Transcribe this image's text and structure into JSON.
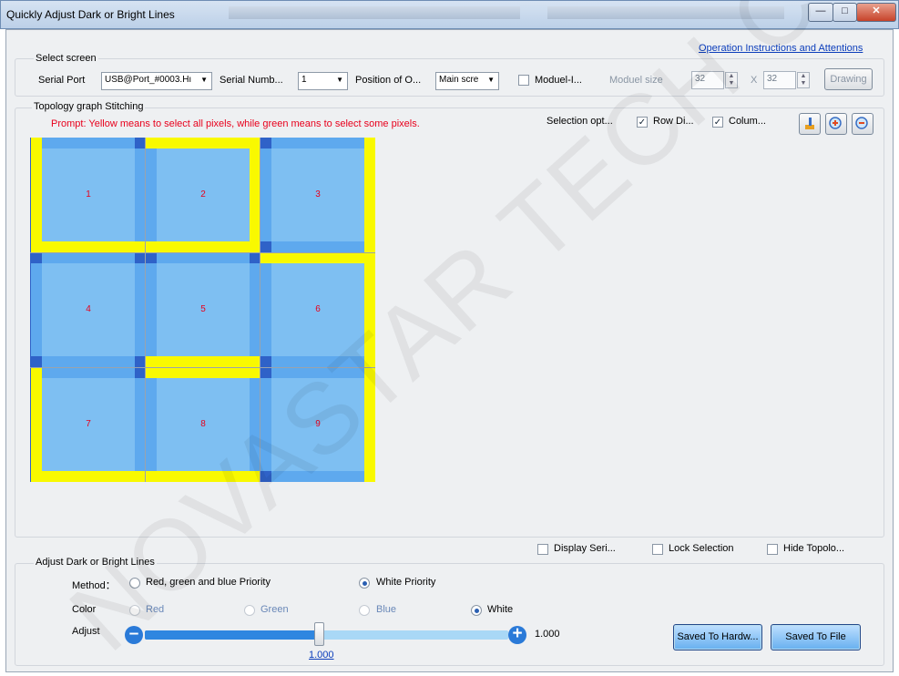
{
  "window": {
    "title": "Quickly Adjust Dark or Bright Lines"
  },
  "select_screen": {
    "group_label": "Select screen",
    "operation_link": "Operation Instructions and Attentions",
    "serial_port_label": "Serial Port",
    "serial_port_value": "USB@Port_#0003.Hı",
    "serial_number_label": "Serial Numb...",
    "serial_number_value": "1",
    "position_label": "Position of O...",
    "position_value": "Main scre",
    "module_checkbox_label": "Moduel-I...",
    "module_size_label": "Moduel size",
    "module_width": "32",
    "module_x": "X",
    "module_height": "32",
    "drawing_button": "Drawing"
  },
  "topology": {
    "group_label": "Topology graph Stitching",
    "prompt": "Prompt: Yellow means to select all pixels, while green means to select some pixels.",
    "selection_label": "Selection opt...",
    "row_checkbox_label": "Row Di...",
    "column_checkbox_label": "Colum...",
    "cells": [
      "1",
      "2",
      "3",
      "4",
      "5",
      "6",
      "7",
      "8",
      "9"
    ],
    "display_serial_label": "Display Seri...",
    "lock_selection_label": "Lock Selection",
    "hide_topology_label": "Hide Topolo..."
  },
  "adjust": {
    "group_label": "Adjust Dark or Bright Lines",
    "method_label": "Method：",
    "method_rgb": "Red, green and blue Priority",
    "method_white": "White Priority",
    "color_label": "Color",
    "color_red": "Red",
    "color_green": "Green",
    "color_blue": "Blue",
    "color_white": "White",
    "adjust_label": "Adjust",
    "value_right": "1.000",
    "value_below": "1.000",
    "slider_fraction": 0.48,
    "save_hardware_button": "Saved To Hardw...",
    "save_file_button": "Saved To File"
  },
  "watermark": "NOVASTAR TECH CO., LTD",
  "colors": {
    "select_all": "#f9f900",
    "module_face": "#7ebff2",
    "module_edge": "#5ea9ee",
    "prompt_text": "#e8001c",
    "link": "#0b3dbb"
  }
}
